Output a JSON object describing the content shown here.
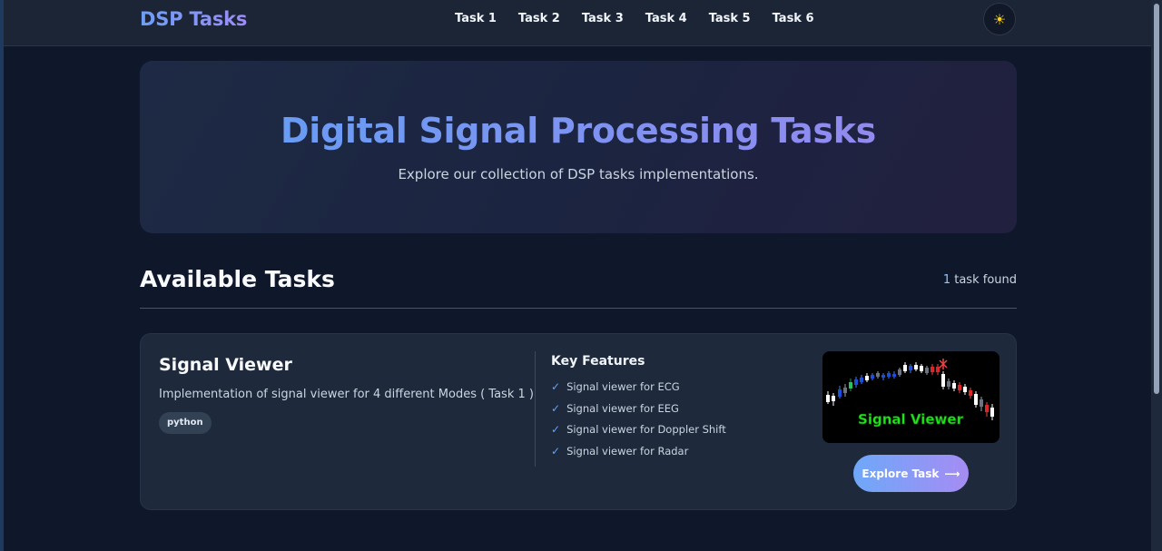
{
  "header": {
    "brand": "DSP Tasks",
    "nav": [
      "Task 1",
      "Task 2",
      "Task 3",
      "Task 4",
      "Task 5",
      "Task 6"
    ],
    "theme_icon": "sun-icon"
  },
  "hero": {
    "title": "Digital Signal Processing Tasks",
    "subtitle": "Explore our collection of DSP tasks implementations."
  },
  "section": {
    "title": "Available Tasks",
    "count_num": "1",
    "count_text": " task found"
  },
  "task": {
    "title": "Signal Viewer",
    "description": "Implementation of signal viewer for 4 different Modes ( Task 1 )",
    "tag": "python",
    "features_title": "Key Features",
    "features": [
      "Signal viewer for ECG",
      "Signal viewer for EEG",
      "Signal viewer for Doppler Shift",
      "Signal viewer for Radar"
    ],
    "image_caption": "Signal Viewer",
    "button_label": "Explore Task",
    "button_icon": "arrow-right-icon"
  },
  "colors": {
    "background": "#0f172a",
    "card": "#1e293b",
    "accent_blue": "#60a5fa",
    "accent_purple": "#a58cf3"
  }
}
